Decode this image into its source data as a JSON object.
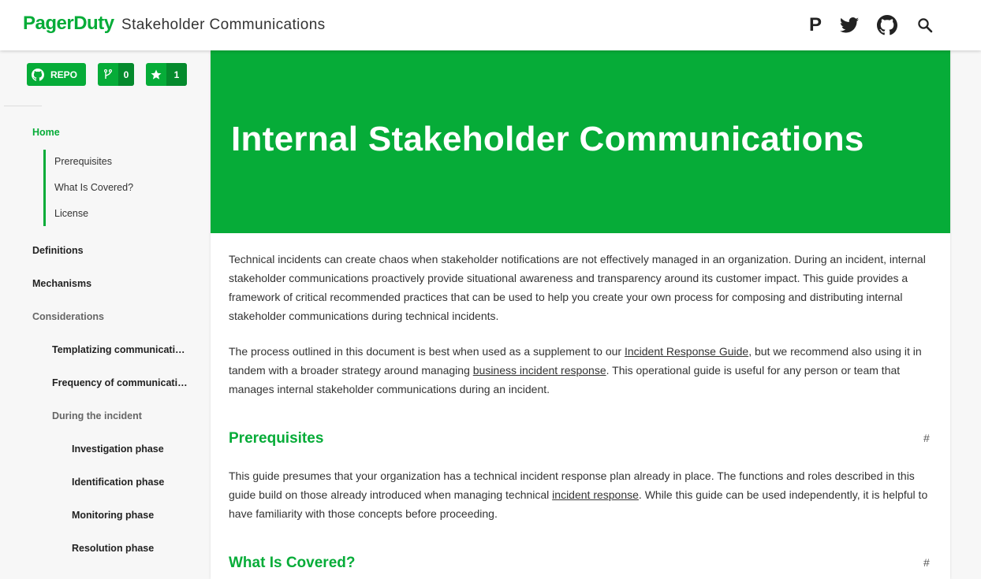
{
  "header": {
    "logo": "PagerDuty",
    "site_title": "Stakeholder Communications",
    "icons": [
      "pagerduty-icon",
      "twitter-icon",
      "github-icon",
      "search-icon"
    ],
    "pd_glyph": "P"
  },
  "sidebar": {
    "badges": {
      "repo_label": "REPO",
      "forks_count": "0",
      "stars_count": "1"
    },
    "items": [
      {
        "label": "Home"
      },
      {
        "label": "Definitions"
      },
      {
        "label": "Mechanisms"
      },
      {
        "label": "Considerations"
      },
      {
        "label": "Templatizing communications"
      },
      {
        "label": "Frequency of communications"
      },
      {
        "label": "During the incident"
      },
      {
        "label": "Investigation phase"
      },
      {
        "label": "Identification phase"
      },
      {
        "label": "Monitoring phase"
      },
      {
        "label": "Resolution phase"
      }
    ],
    "subitems": [
      {
        "label": "Prerequisites"
      },
      {
        "label": "What Is Covered?"
      },
      {
        "label": "License"
      }
    ]
  },
  "main": {
    "hero_title": "Internal Stakeholder Communications",
    "intro": "Technical incidents can create chaos when stakeholder notifications are not effectively managed in an organization. During an incident, internal stakeholder communications proactively provide situational awareness and transparency around its customer impact. This guide provides a framework of critical recommended practices that can be used to help you create your own process for composing and distributing internal stakeholder communications during technical incidents.",
    "p2": {
      "t1": "The process outlined in this document is best when used as a supplement to our ",
      "link1": "Incident Response Guide",
      "t2": ", but we recommend also using it in tandem with a broader strategy around managing ",
      "link2": "business incident response",
      "t3": ". This operational guide is useful for any person or team that manages internal stakeholder communications during an incident."
    },
    "prereq_heading": "Prerequisites",
    "prereq": {
      "t1": "This guide presumes that your organization has a technical incident response plan already in place. The functions and roles described in this guide build on those already introduced when managing technical ",
      "link": "incident response",
      "t2": ". While this guide can be used independently, it is helpful to have familiarity with those concepts before proceeding."
    },
    "covered_heading": "What Is Covered?",
    "anchor_symbol": "#"
  },
  "colors": {
    "brand_green": "#06ac38",
    "brand_green_dark": "#058a2d"
  }
}
